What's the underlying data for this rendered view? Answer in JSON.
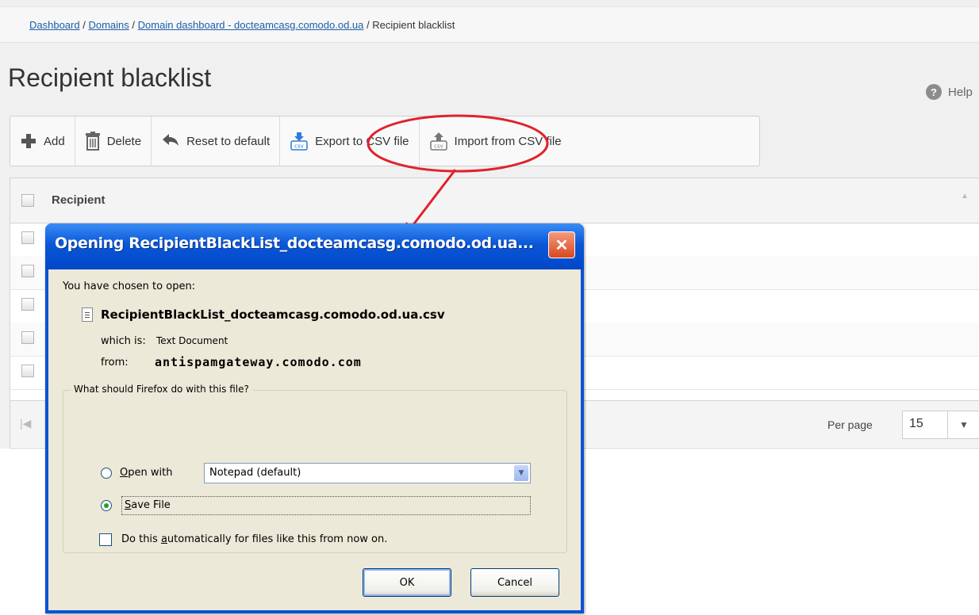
{
  "breadcrumb": {
    "dashboard": "Dashboard",
    "domains": "Domains",
    "domain_dashboard": "Domain dashboard - docteamcasg.comodo.od.ua",
    "current": "Recipient blacklist",
    "separator": "/"
  },
  "page": {
    "title": "Recipient blacklist",
    "help_label": "Help",
    "help_icon": "?"
  },
  "toolbar": {
    "add": "Add",
    "delete": "Delete",
    "reset": "Reset to default",
    "export": "Export to CSV file",
    "import": "Import from CSV file",
    "csv_icon_text": "csv"
  },
  "table": {
    "header": "Recipient",
    "rows": 5,
    "first_page_icon": "|◀",
    "per_page_label": "Per page",
    "per_page_value": "15"
  },
  "dialog": {
    "title": "Opening RecipientBlackList_docteamcasg.comodo.od.ua...",
    "close_glyph": "✕",
    "chosen_label": "You have chosen to open:",
    "file_name": "RecipientBlackList_docteamcasg.comodo.od.ua.csv",
    "which_is_label": "which is:",
    "which_is_value": "Text Document",
    "from_label": "from:",
    "from_value": "antispamgateway.comodo.com",
    "question": "What should Firefox do with this file?",
    "open_with_prefix": "O",
    "open_with_rest": "pen with",
    "open_with_value": "Notepad (default)",
    "save_prefix": "S",
    "save_rest": "ave File",
    "auto_prefix": "Do this ",
    "auto_u": "a",
    "auto_rest": "utomatically for files like this from now on.",
    "ok": "OK",
    "cancel": "Cancel",
    "selected_option": "save_file",
    "auto_checked": false
  },
  "colors": {
    "highlight": "#e0222a",
    "link": "#1a5fa8",
    "dialog_title": "#0a52d6",
    "dialog_close": "#d9481f"
  }
}
